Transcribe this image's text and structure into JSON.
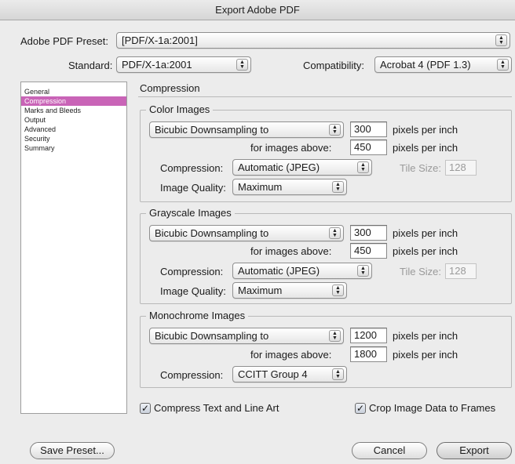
{
  "window": {
    "title": "Export Adobe PDF"
  },
  "preset": {
    "label": "Adobe PDF Preset:",
    "value": "[PDF/X-1a:2001]"
  },
  "standard": {
    "label": "Standard:",
    "value": "PDF/X-1a:2001"
  },
  "compatibility": {
    "label": "Compatibility:",
    "value": "Acrobat 4 (PDF 1.3)"
  },
  "sidebar": {
    "items": [
      {
        "label": "General"
      },
      {
        "label": "Compression"
      },
      {
        "label": "Marks and Bleeds"
      },
      {
        "label": "Output"
      },
      {
        "label": "Advanced"
      },
      {
        "label": "Security"
      },
      {
        "label": "Summary"
      }
    ],
    "selected_index": 1
  },
  "panel": {
    "title": "Compression"
  },
  "color_images": {
    "title": "Color Images",
    "downsampling": "Bicubic Downsampling to",
    "ppi": "300",
    "ppi_unit": "pixels per inch",
    "above_label": "for images above:",
    "above_value": "450",
    "above_unit": "pixels per inch",
    "compression_label": "Compression:",
    "compression_value": "Automatic (JPEG)",
    "tile_label": "Tile Size:",
    "tile_value": "128",
    "quality_label": "Image Quality:",
    "quality_value": "Maximum"
  },
  "grayscale_images": {
    "title": "Grayscale Images",
    "downsampling": "Bicubic Downsampling to",
    "ppi": "300",
    "ppi_unit": "pixels per inch",
    "above_label": "for images above:",
    "above_value": "450",
    "above_unit": "pixels per inch",
    "compression_label": "Compression:",
    "compression_value": "Automatic (JPEG)",
    "tile_label": "Tile Size:",
    "tile_value": "128",
    "quality_label": "Image Quality:",
    "quality_value": "Maximum"
  },
  "monochrome_images": {
    "title": "Monochrome Images",
    "downsampling": "Bicubic Downsampling to",
    "ppi": "1200",
    "ppi_unit": "pixels per inch",
    "above_label": "for images above:",
    "above_value": "1800",
    "above_unit": "pixels per inch",
    "compression_label": "Compression:",
    "compression_value": "CCITT Group 4"
  },
  "options": {
    "compress_text": {
      "label": "Compress Text and Line Art",
      "checked": true
    },
    "crop_image": {
      "label": "Crop Image Data to Frames",
      "checked": true
    },
    "check_glyph": "✓"
  },
  "buttons": {
    "save_preset": "Save Preset...",
    "cancel": "Cancel",
    "export": "Export"
  },
  "icons": {
    "stepper": "updown-arrows-icon"
  },
  "colors": {
    "selection": "#c964b7"
  }
}
